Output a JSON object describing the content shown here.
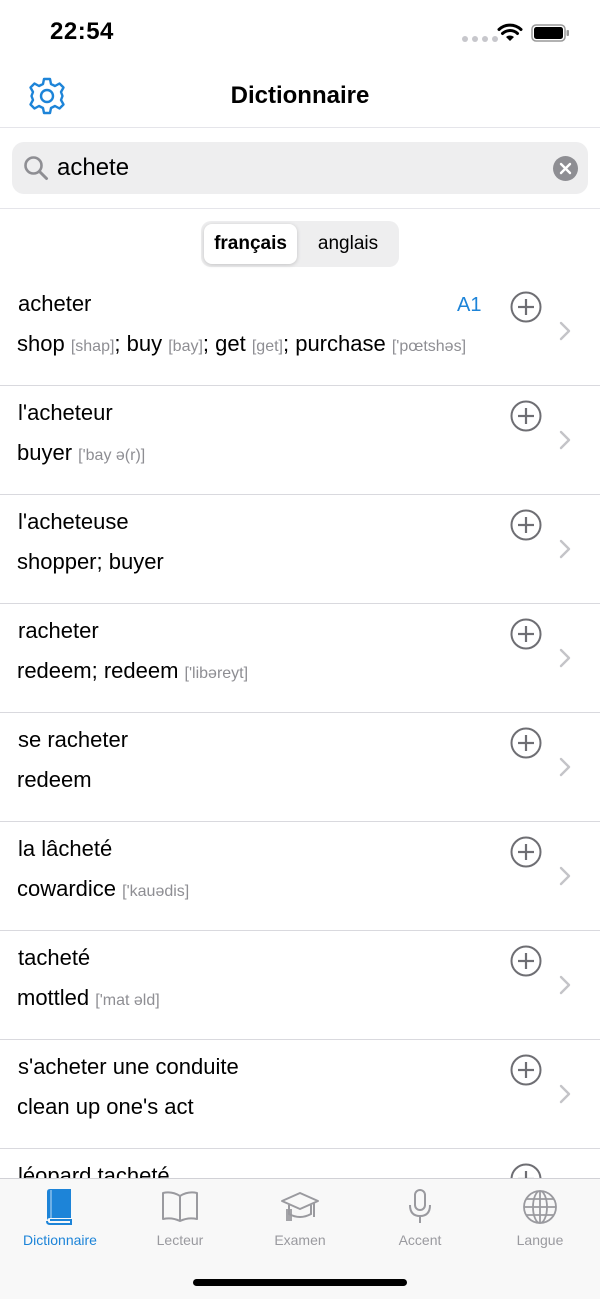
{
  "status": {
    "time": "22:54"
  },
  "nav": {
    "title": "Dictionnaire"
  },
  "search": {
    "value": "achete",
    "placeholder": ""
  },
  "segments": [
    {
      "label": "français",
      "active": true
    },
    {
      "label": "anglais",
      "active": false
    }
  ],
  "results": [
    {
      "word": "acheter",
      "level": "A1",
      "parts": [
        {
          "t": "shop "
        },
        {
          "p": "[shap]"
        },
        {
          "t": "; buy "
        },
        {
          "p": "[bay]"
        },
        {
          "t": "; get "
        },
        {
          "p": "[get]"
        },
        {
          "t": "; purchase "
        },
        {
          "p": "['pœtshəs]"
        }
      ]
    },
    {
      "word": "l'acheteur",
      "level": "",
      "parts": [
        {
          "t": "buyer "
        },
        {
          "p": "['bay ə(r)]"
        }
      ]
    },
    {
      "word": "l'acheteuse",
      "level": "",
      "parts": [
        {
          "t": "shopper; buyer"
        }
      ]
    },
    {
      "word": "racheter",
      "level": "",
      "parts": [
        {
          "t": "redeem; redeem "
        },
        {
          "p": "['libəreyt]"
        }
      ]
    },
    {
      "word": "se racheter",
      "level": "",
      "parts": [
        {
          "t": "redeem"
        }
      ]
    },
    {
      "word": "la lâcheté",
      "level": "",
      "parts": [
        {
          "t": "cowardice "
        },
        {
          "p": "['kauədis]"
        }
      ]
    },
    {
      "word": "tacheté",
      "level": "",
      "parts": [
        {
          "t": "mottled "
        },
        {
          "p": "['mat əld]"
        }
      ]
    },
    {
      "word": "s'acheter une conduite",
      "level": "",
      "parts": [
        {
          "t": "clean up one's act"
        }
      ]
    },
    {
      "word": "léopard tacheté",
      "level": "",
      "parts": []
    }
  ],
  "tabs": [
    {
      "label": "Dictionnaire",
      "icon": "book-icon",
      "active": true
    },
    {
      "label": "Lecteur",
      "icon": "open-book-icon",
      "active": false
    },
    {
      "label": "Examen",
      "icon": "graduation-cap-icon",
      "active": false
    },
    {
      "label": "Accent",
      "icon": "microphone-icon",
      "active": false
    },
    {
      "label": "Langue",
      "icon": "globe-icon",
      "active": false
    }
  ],
  "colors": {
    "accent": "#1d84d8",
    "inactive": "#9a9a9f",
    "separator": "#d9d9de",
    "search_bg": "#eeeeef"
  }
}
